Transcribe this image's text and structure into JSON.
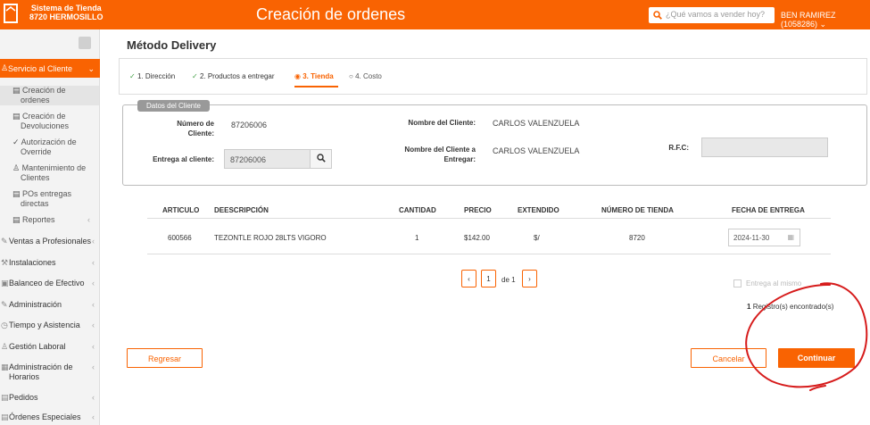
{
  "header": {
    "store_line1": "Sistema de Tienda",
    "store_line2": "8720 HERMOSILLO",
    "title": "Creación de ordenes",
    "search_placeholder": "¿Qué vamos a vender hoy?",
    "user": "BEN RAMIREZ (1058286) ⌄",
    "accent": "#f96302"
  },
  "sidebar": {
    "active": "Servicio al Cliente",
    "sub_items": [
      {
        "icon": "▤",
        "label1": "Creación de",
        "label2": "ordenes"
      },
      {
        "icon": "▤",
        "label1": "Creación de",
        "label2": "Devoluciones"
      },
      {
        "icon": "✓",
        "label1": "Autorización de",
        "label2": "Override"
      },
      {
        "icon": "♙",
        "label1": "Mantenimiento de",
        "label2": "Clientes"
      },
      {
        "icon": "▤",
        "label1": "POs entregas",
        "label2": "directas"
      },
      {
        "icon": "▤",
        "label1": "Reportes",
        "label2": ""
      }
    ],
    "menu": [
      "Ventas a Profesionales",
      "Instalaciones",
      "Balanceo de Efectivo",
      "Administración",
      "Tiempo y Asistencia",
      "Gestión Laboral",
      "Administración de",
      "Horarios",
      "Pedidos",
      "Órdenes Especiales"
    ]
  },
  "page": {
    "section_title": "Método Delivery"
  },
  "steps": [
    "1. Dirección",
    "2. Productos a entregar",
    "3. Tienda",
    "4. Costo"
  ],
  "client": {
    "badge": "Datos del Cliente",
    "numero_label1": "Número de",
    "numero_label2": "Cliente:",
    "numero_value": "87206006",
    "entrega_label": "Entrega al cliente:",
    "entrega_value": "87206006",
    "nombre_label": "Nombre del Cliente:",
    "nombre_value": "CARLOS VALENZUELA",
    "nombre_entregar_label1": "Nombre del Cliente a",
    "nombre_entregar_label2": "Entregar:",
    "nombre_entregar_value": "CARLOS VALENZUELA",
    "rfc_label": "R.F.C:",
    "rfc_value": ""
  },
  "table": {
    "headers": [
      "ARTICULO",
      "DEESCRIPCIÓN",
      "CANTIDAD",
      "PRECIO",
      "EXTENDIDO",
      "NÚMERO DE TIENDA",
      "FECHA DE ENTREGA"
    ],
    "rows": [
      [
        "600566",
        "TEZONTLE ROJO 28LTS VIGORO",
        "1",
        "$142.00",
        "$/",
        "8720",
        "2024-11-30"
      ]
    ]
  },
  "pagination": {
    "prev": "‹",
    "page": "1",
    "of": "de 1",
    "next": "›"
  },
  "options": {
    "entrega_mismo": "Entrega al mismo"
  },
  "records": {
    "count": "1",
    "text": "Registro(s) encontrado(s)"
  },
  "buttons": {
    "regresar": "Regresar",
    "cancelar": "Cancelar",
    "continuar": "Continuar"
  }
}
